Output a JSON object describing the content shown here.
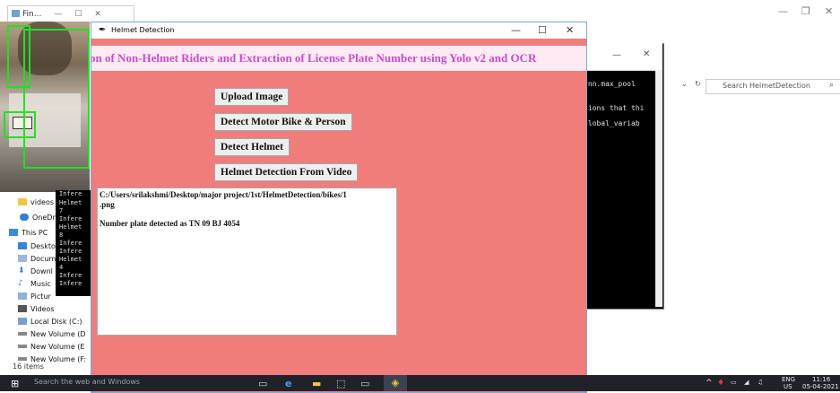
{
  "explorer": {
    "tab_title": "Fin...",
    "nav_items": [
      "videos",
      "OneDriv",
      "This PC",
      "Deskto",
      "Docum",
      "Downl",
      "Music",
      "Pictur",
      "Videos",
      "Local Disk (C:)",
      "New Volume (D",
      "New Volume (E",
      "New Volume (F:"
    ],
    "items_count": "16 items"
  },
  "console": {
    "lines": [
      ".nn.max_pool",
      "tions that thi",
      "global_variab"
    ],
    "left_lines": [
      "Infere",
      "Helmet",
      "7",
      "Infere",
      "Helmet",
      "8",
      "Infere",
      "Infere",
      "Helmet",
      "4",
      "Infere",
      "Infere"
    ]
  },
  "search_box": {
    "placeholder": "Search HelmetDetection"
  },
  "helmet_window": {
    "title": "Helmet Detection",
    "header": "on of Non-Helmet Riders and Extraction of License Plate Number using Yolo v2 and OCR",
    "buttons": {
      "upload": "Upload Image",
      "detect_bike": "Detect Motor Bike & Person",
      "detect_helmet": "Detect Helmet",
      "video": "Helmet Detection From Video"
    },
    "output": {
      "path_line1": "C:/Users/srilakshmi/Desktop/major project/1st/HelmetDetection/bikes/1",
      "path_line2": ".png",
      "result": "Number plate detected as TN 09 BJ 4054"
    },
    "controls": {
      "minimize": "—",
      "maximize": "☐",
      "close": "✕"
    }
  },
  "taskbar": {
    "search_placeholder": "Search the web and Windows",
    "lang_top": "ENG",
    "lang_bottom": "US",
    "time": "11:16",
    "date": "05-04-2021"
  },
  "colors": {
    "window_bg": "#f07c7c",
    "header_text": "#c94bd0",
    "header_bg": "#fdeaf2",
    "taskbar": "#1f2329"
  }
}
